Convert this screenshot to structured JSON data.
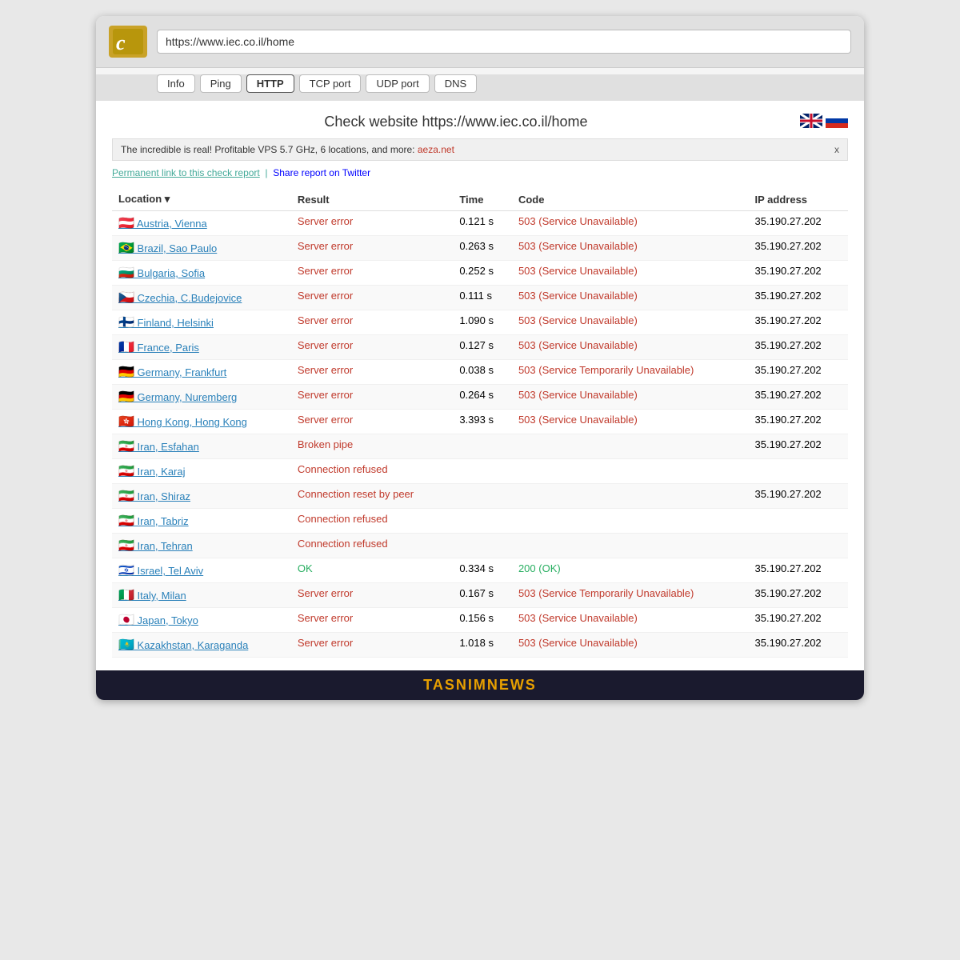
{
  "browser": {
    "url": "https://www.iec.co.il/home",
    "buttons": [
      "Info",
      "Ping",
      "HTTP",
      "TCP port",
      "UDP port",
      "DNS"
    ],
    "active_button": "HTTP"
  },
  "page": {
    "title": "Check website  https://www.iec.co.il/home",
    "ad_text": "The incredible is real! Profitable VPS 5.7 GHz, 6 locations, and more: ",
    "ad_link": "aeza.net",
    "perm_link_text": "Permanent link to this check report",
    "share_text": "Share report",
    "share_link_text": " on Twitter"
  },
  "table": {
    "headers": [
      "Location ▾",
      "Result",
      "Time",
      "Code",
      "IP address"
    ],
    "rows": [
      {
        "flag": "at",
        "location": "Austria, Vienna",
        "result": "Server error",
        "result_type": "error",
        "time": "0.121 s",
        "code": "503 (Service Unavailable)",
        "code_type": "error",
        "ip": "35.190.27.202"
      },
      {
        "flag": "br",
        "location": "Brazil, Sao Paulo",
        "result": "Server error",
        "result_type": "error",
        "time": "0.263 s",
        "code": "503 (Service Unavailable)",
        "code_type": "error",
        "ip": "35.190.27.202"
      },
      {
        "flag": "bg",
        "location": "Bulgaria, Sofia",
        "result": "Server error",
        "result_type": "error",
        "time": "0.252 s",
        "code": "503 (Service Unavailable)",
        "code_type": "error",
        "ip": "35.190.27.202"
      },
      {
        "flag": "cz",
        "location": "Czechia, C.Budejovice",
        "result": "Server error",
        "result_type": "error",
        "time": "0.111 s",
        "code": "503 (Service Unavailable)",
        "code_type": "error",
        "ip": "35.190.27.202"
      },
      {
        "flag": "fi",
        "location": "Finland, Helsinki",
        "result": "Server error",
        "result_type": "error",
        "time": "1.090 s",
        "code": "503 (Service Unavailable)",
        "code_type": "error",
        "ip": "35.190.27.202"
      },
      {
        "flag": "fr",
        "location": "France, Paris",
        "result": "Server error",
        "result_type": "error",
        "time": "0.127 s",
        "code": "503 (Service Unavailable)",
        "code_type": "error",
        "ip": "35.190.27.202"
      },
      {
        "flag": "de",
        "location": "Germany, Frankfurt",
        "result": "Server error",
        "result_type": "error",
        "time": "0.038 s",
        "code": "503 (Service Temporarily Unavailable)",
        "code_type": "error",
        "ip": "35.190.27.202"
      },
      {
        "flag": "de",
        "location": "Germany, Nuremberg",
        "result": "Server error",
        "result_type": "error",
        "time": "0.264 s",
        "code": "503 (Service Unavailable)",
        "code_type": "error",
        "ip": "35.190.27.202"
      },
      {
        "flag": "hk",
        "location": "Hong Kong, Hong Kong",
        "result": "Server error",
        "result_type": "error",
        "time": "3.393 s",
        "code": "503 (Service Unavailable)",
        "code_type": "error",
        "ip": "35.190.27.202"
      },
      {
        "flag": "ir",
        "location": "Iran, Esfahan",
        "result": "Broken pipe",
        "result_type": "error",
        "time": "",
        "code": "",
        "code_type": "",
        "ip": "35.190.27.202"
      },
      {
        "flag": "ir",
        "location": "Iran, Karaj",
        "result": "Connection refused",
        "result_type": "error",
        "time": "",
        "code": "",
        "code_type": "",
        "ip": ""
      },
      {
        "flag": "ir",
        "location": "Iran, Shiraz",
        "result": "Connection reset by peer",
        "result_type": "error",
        "time": "",
        "code": "",
        "code_type": "",
        "ip": "35.190.27.202"
      },
      {
        "flag": "ir",
        "location": "Iran, Tabriz",
        "result": "Connection refused",
        "result_type": "error",
        "time": "",
        "code": "",
        "code_type": "",
        "ip": ""
      },
      {
        "flag": "ir",
        "location": "Iran, Tehran",
        "result": "Connection refused",
        "result_type": "error",
        "time": "",
        "code": "",
        "code_type": "",
        "ip": ""
      },
      {
        "flag": "il",
        "location": "Israel, Tel Aviv",
        "result": "OK",
        "result_type": "ok",
        "time": "0.334 s",
        "code": "200 (OK)",
        "code_type": "ok",
        "ip": "35.190.27.202"
      },
      {
        "flag": "it",
        "location": "Italy, Milan",
        "result": "Server error",
        "result_type": "error",
        "time": "0.167 s",
        "code": "503 (Service Temporarily Unavailable)",
        "code_type": "error",
        "ip": "35.190.27.202"
      },
      {
        "flag": "jp",
        "location": "Japan, Tokyo",
        "result": "Server error",
        "result_type": "error",
        "time": "0.156 s",
        "code": "503 (Service Unavailable)",
        "code_type": "error",
        "ip": "35.190.27.202"
      },
      {
        "flag": "kz",
        "location": "Kazakhstan, Karaganda",
        "result": "Server error",
        "result_type": "error",
        "time": "1.018 s",
        "code": "503 (Service Unavailable)",
        "code_type": "error",
        "ip": "35.190.27.202"
      }
    ]
  },
  "footer": {
    "tasnim": "TASNIMNEWS"
  }
}
